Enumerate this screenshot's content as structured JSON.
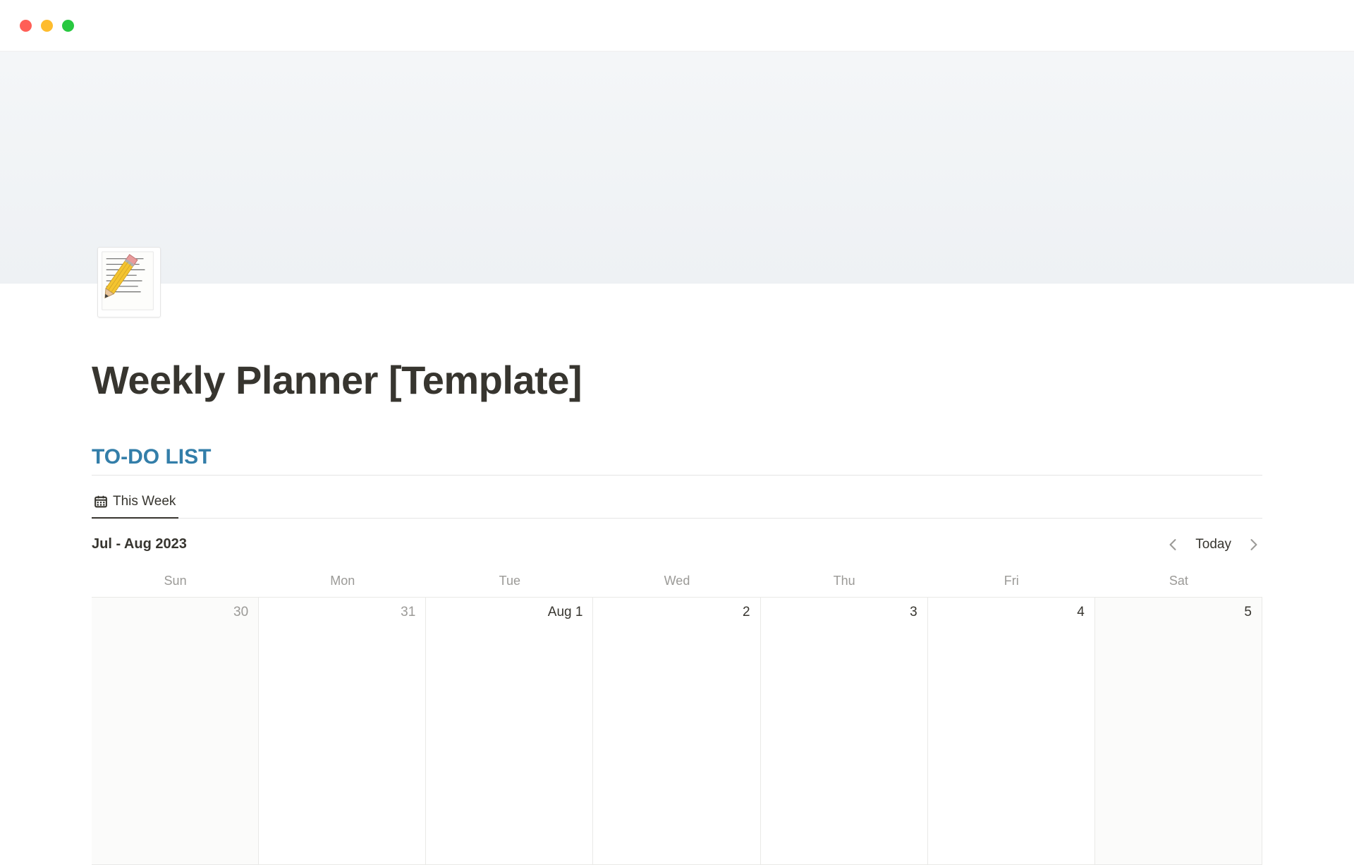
{
  "page": {
    "title": "Weekly Planner [Template]"
  },
  "sections": {
    "todo": {
      "heading": "TO-DO LIST"
    }
  },
  "views": {
    "tabs": [
      {
        "label": "This Week",
        "icon": "calendar-icon"
      }
    ]
  },
  "calendar": {
    "month_label": "Jul - Aug 2023",
    "today_button": "Today",
    "day_headers": [
      "Sun",
      "Mon",
      "Tue",
      "Wed",
      "Thu",
      "Fri",
      "Sat"
    ],
    "days": [
      {
        "label": "30",
        "weekend": true,
        "other_month": true
      },
      {
        "label": "31",
        "weekend": false,
        "other_month": true
      },
      {
        "label": "Aug 1",
        "weekend": false,
        "other_month": false
      },
      {
        "label": "2",
        "weekend": false,
        "other_month": false
      },
      {
        "label": "3",
        "weekend": false,
        "other_month": false
      },
      {
        "label": "4",
        "weekend": false,
        "other_month": false
      },
      {
        "label": "5",
        "weekend": true,
        "other_month": false
      }
    ]
  }
}
